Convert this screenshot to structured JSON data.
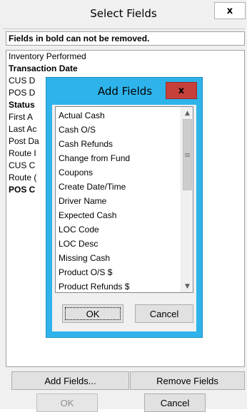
{
  "window": {
    "title": "Select Fields",
    "close_glyph": "x"
  },
  "notice": "Fields in bold can not be removed.",
  "fields": [
    {
      "label": "Inventory Performed",
      "bold": false
    },
    {
      "label": "Transaction Date",
      "bold": true
    },
    {
      "label": "CUS D",
      "bold": false
    },
    {
      "label": "POS D",
      "bold": false
    },
    {
      "label": "Status",
      "bold": true
    },
    {
      "label": "First A",
      "bold": false
    },
    {
      "label": "Last Ac",
      "bold": false
    },
    {
      "label": "Post Da",
      "bold": false
    },
    {
      "label": "Route I",
      "bold": false
    },
    {
      "label": "CUS C",
      "bold": false
    },
    {
      "label": "Route (",
      "bold": false
    },
    {
      "label": "POS C",
      "bold": true
    }
  ],
  "buttons": {
    "add_fields": "Add Fields...",
    "remove_fields": "Remove Fields",
    "ok": "OK",
    "cancel": "Cancel"
  },
  "modal": {
    "title": "Add Fields",
    "close_glyph": "x",
    "items": [
      "Actual Cash",
      "Cash O/S",
      "Cash Refunds",
      "Change from Fund",
      "Coupons",
      "Create Date/Time",
      "Driver Name",
      "Expected Cash",
      "LOC Code",
      "LOC Desc",
      "Missing Cash",
      "Product O/S $",
      "Product Refunds $"
    ],
    "ok": "OK",
    "cancel": "Cancel"
  },
  "icons": {
    "scroll_up": "chevron-up-icon",
    "scroll_down": "chevron-down-icon",
    "scroll_grip": "grip-icon"
  },
  "colors": {
    "modal_frame": "#2fb3eb",
    "modal_close": "#c7413a"
  }
}
